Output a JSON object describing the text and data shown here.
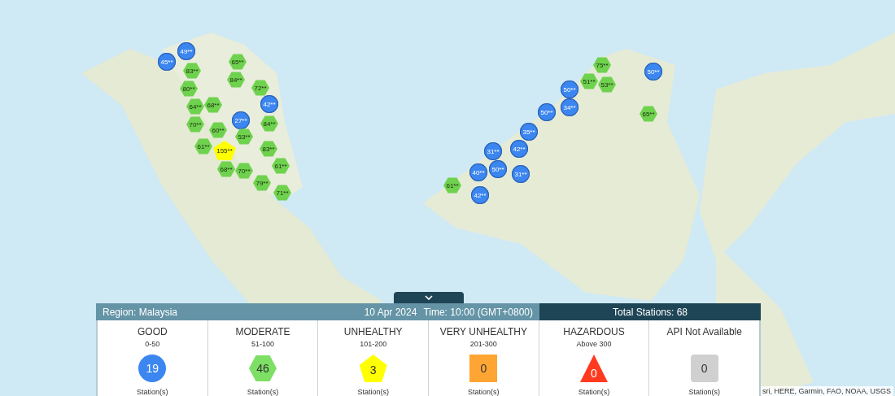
{
  "map": {
    "markers": [
      {
        "value": "45**",
        "kind": "circle"
      },
      {
        "value": "49**",
        "kind": "circle"
      },
      {
        "value": "83**",
        "kind": "hexagon"
      },
      {
        "value": "65**",
        "kind": "hexagon"
      },
      {
        "value": "84**",
        "kind": "hexagon"
      },
      {
        "value": "80**",
        "kind": "hexagon"
      },
      {
        "value": "72**",
        "kind": "hexagon"
      },
      {
        "value": "64**",
        "kind": "hexagon"
      },
      {
        "value": "68**",
        "kind": "hexagon"
      },
      {
        "value": "70**",
        "kind": "hexagon"
      },
      {
        "value": "42**",
        "kind": "circle"
      },
      {
        "value": "27**",
        "kind": "circle"
      },
      {
        "value": "84**",
        "kind": "hexagon"
      },
      {
        "value": "60**",
        "kind": "hexagon"
      },
      {
        "value": "53**",
        "kind": "hexagon"
      },
      {
        "value": "61**",
        "kind": "hexagon"
      },
      {
        "value": "155**",
        "kind": "pentagon"
      },
      {
        "value": "83**",
        "kind": "hexagon"
      },
      {
        "value": "68**",
        "kind": "hexagon"
      },
      {
        "value": "70**",
        "kind": "hexagon"
      },
      {
        "value": "79**",
        "kind": "hexagon"
      },
      {
        "value": "61**",
        "kind": "hexagon"
      },
      {
        "value": "71**",
        "kind": "hexagon"
      },
      {
        "value": "75**",
        "kind": "hexagon"
      },
      {
        "value": "50**",
        "kind": "circle"
      },
      {
        "value": "51**",
        "kind": "hexagon"
      },
      {
        "value": "53**",
        "kind": "hexagon"
      },
      {
        "value": "50**",
        "kind": "circle"
      },
      {
        "value": "34**",
        "kind": "circle"
      },
      {
        "value": "50**",
        "kind": "circle"
      },
      {
        "value": "65**",
        "kind": "hexagon"
      },
      {
        "value": "35**",
        "kind": "circle"
      },
      {
        "value": "42**",
        "kind": "circle"
      },
      {
        "value": "31**",
        "kind": "circle"
      },
      {
        "value": "40**",
        "kind": "circle"
      },
      {
        "value": "50**",
        "kind": "circle"
      },
      {
        "value": "31**",
        "kind": "circle"
      },
      {
        "value": "61**",
        "kind": "hexagon"
      },
      {
        "value": "42**",
        "kind": "circle"
      }
    ],
    "attribution": "sri, HERE, Garmin, FAO, NOAA, USGS"
  },
  "panel": {
    "region": "Region: Malaysia",
    "date": "10 Apr 2024",
    "time": "Time: 10:00 (GMT+0800)",
    "total": "Total Stations: 68",
    "categories": [
      {
        "name": "GOOD",
        "range": "0-50",
        "count": "19",
        "kind": "circle",
        "color": "#3b86f0",
        "unit": "Station(s)"
      },
      {
        "name": "MODERATE",
        "range": "51-100",
        "count": "46",
        "kind": "hexagon",
        "color": "#7ddf64",
        "unit": "Station(s)"
      },
      {
        "name": "UNHEALTHY",
        "range": "101-200",
        "count": "3",
        "kind": "pentagon",
        "color": "#ffff00",
        "unit": "Station(s)"
      },
      {
        "name": "VERY UNHEALTHY",
        "range": "201-300",
        "count": "0",
        "kind": "square",
        "color": "#ffa533",
        "unit": "Station(s)"
      },
      {
        "name": "HAZARDOUS",
        "range": "Above 300",
        "count": "0",
        "kind": "triangle",
        "color": "#ff3a1f",
        "unit": "Station(s)"
      },
      {
        "name": "API Not Available",
        "count": "0",
        "kind": "rounded",
        "color": "#d0d0d0",
        "unit": "Station(s)"
      }
    ]
  }
}
